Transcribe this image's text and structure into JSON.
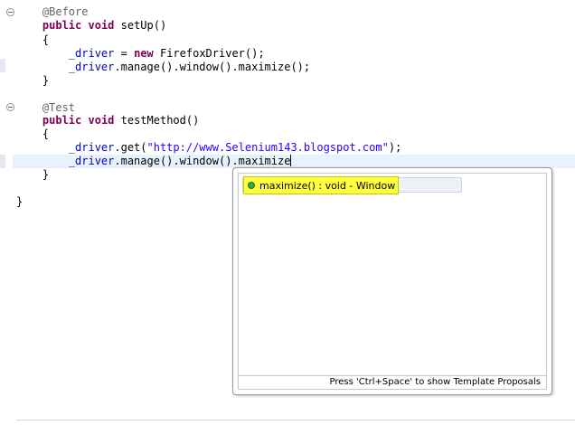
{
  "editor": {
    "lines": {
      "l1": {
        "annotation": "@Before"
      },
      "l2": {
        "kw1": "public",
        "kw2": "void",
        "rest": " setUp()"
      },
      "l3": {
        "text": "{"
      },
      "l4": {
        "field": "_driver",
        "mid": " = ",
        "kw": "new",
        "rest": " FirefoxDriver();"
      },
      "l5": {
        "field": "_driver",
        "rest": ".manage().window().maximize();"
      },
      "l6": {
        "text": "}"
      },
      "l8": {
        "annotation": "@Test"
      },
      "l9": {
        "kw1": "public",
        "kw2": "void",
        "rest": " testMethod()"
      },
      "l10": {
        "text": "{"
      },
      "l11": {
        "field": "_driver",
        "mid": ".get(",
        "string": "\"http://www.Selenium143.blogspot.com\"",
        "rest": ");"
      },
      "l12": {
        "field": "_driver",
        "mid": ".manage().window().",
        "typed": "maximize"
      },
      "l13": {
        "text": "}"
      },
      "l15": {
        "text": "}"
      }
    }
  },
  "content_assist": {
    "proposals": [
      {
        "label": "maximize() : void - Window",
        "icon": "public-method-icon"
      }
    ],
    "status": "Press 'Ctrl+Space' to show Template Proposals"
  },
  "colors": {
    "keyword": "#7f0055",
    "annotation": "#646464",
    "field": "#0000c0",
    "string": "#2a00ff",
    "selection_highlight": "#ffff40",
    "current_line": "#e8f2fe"
  }
}
